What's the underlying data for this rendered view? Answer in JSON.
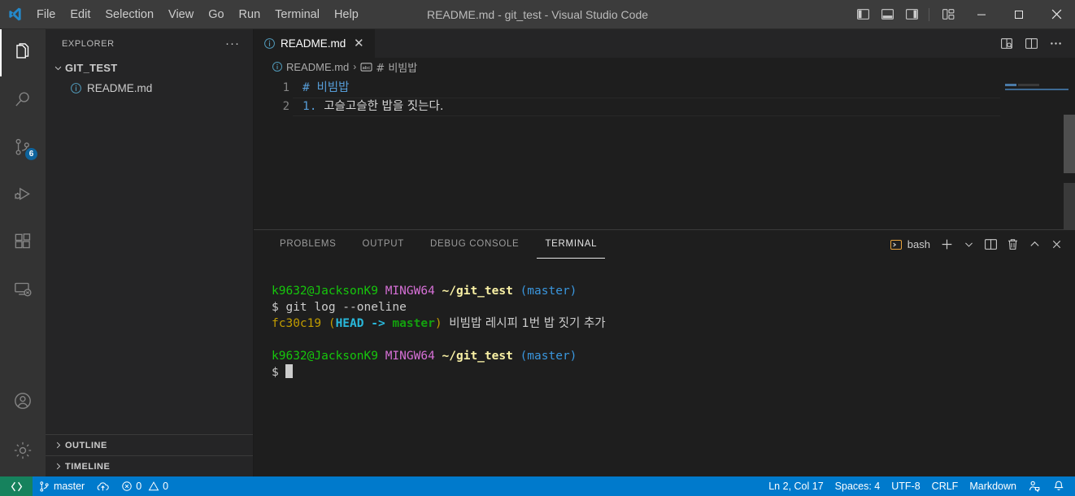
{
  "titlebar": {
    "logo_icon": "vscode-logo-icon",
    "menu": [
      {
        "label": "File"
      },
      {
        "label": "Edit"
      },
      {
        "label": "Selection"
      },
      {
        "label": "View"
      },
      {
        "label": "Go"
      },
      {
        "label": "Run"
      },
      {
        "label": "Terminal"
      },
      {
        "label": "Help"
      }
    ],
    "window_title": "README.md - git_test - Visual Studio Code",
    "layout_controls": [
      {
        "icon": "toggle-primary-sidebar-icon"
      },
      {
        "icon": "toggle-panel-icon"
      },
      {
        "icon": "toggle-secondary-sidebar-icon"
      },
      {
        "icon": "customize-layout-icon"
      }
    ],
    "window_controls": [
      {
        "icon": "minimize-icon"
      },
      {
        "icon": "maximize-icon"
      },
      {
        "icon": "close-icon"
      }
    ]
  },
  "activitybar": {
    "items": [
      {
        "name": "explorer",
        "icon": "files-icon",
        "active": true,
        "badge": null
      },
      {
        "name": "search",
        "icon": "search-icon",
        "active": false,
        "badge": null
      },
      {
        "name": "source-control",
        "icon": "source-control-icon",
        "active": false,
        "badge": "6"
      },
      {
        "name": "run-and-debug",
        "icon": "run-debug-icon",
        "active": false,
        "badge": null
      },
      {
        "name": "extensions",
        "icon": "extensions-icon",
        "active": false,
        "badge": null
      },
      {
        "name": "remote-explorer",
        "icon": "remote-explorer-icon",
        "active": false,
        "badge": null
      }
    ],
    "bottom_items": [
      {
        "name": "accounts",
        "icon": "account-icon"
      },
      {
        "name": "manage",
        "icon": "gear-icon"
      }
    ]
  },
  "sidebar": {
    "title": "EXPLORER",
    "more_actions": "···",
    "folder": {
      "label": "GIT_TEST",
      "expanded": true,
      "chevron": "chevron-down-icon"
    },
    "files": [
      {
        "label": "README.md",
        "icon": "markdown-info-icon"
      }
    ],
    "sections": [
      {
        "label": "OUTLINE",
        "chevron": "chevron-right-icon"
      },
      {
        "label": "TIMELINE",
        "chevron": "chevron-right-icon"
      }
    ]
  },
  "editor": {
    "tab": {
      "label": "README.md",
      "icon": "markdown-info-icon",
      "close": "✕"
    },
    "actions": [
      {
        "icon": "open-preview-to-side-icon"
      },
      {
        "icon": "split-editor-icon"
      },
      {
        "icon": "more-actions-icon"
      }
    ],
    "breadcrumb": {
      "file": "README.md",
      "file_icon": "markdown-info-icon",
      "separator": "›",
      "symbol_icon": "symbol-string-icon",
      "symbol": "# 비빔밥"
    },
    "lines": [
      {
        "num": "1",
        "hash": "# ",
        "text": "비빔밥",
        "kind": "heading",
        "current": false
      },
      {
        "num": "2",
        "hash": "1. ",
        "text": "고슬고슬한 밥을 짓는다.",
        "kind": "listitem",
        "current": true
      }
    ]
  },
  "panel": {
    "tabs": [
      {
        "label": "PROBLEMS",
        "active": false
      },
      {
        "label": "OUTPUT",
        "active": false
      },
      {
        "label": "DEBUG CONSOLE",
        "active": false
      },
      {
        "label": "TERMINAL",
        "active": true
      }
    ],
    "shell": {
      "label": "bash",
      "icon": "terminal-bash-icon"
    },
    "actions": [
      {
        "icon": "add-terminal-icon"
      },
      {
        "icon": "chevron-down-icon"
      },
      {
        "icon": "split-terminal-icon"
      },
      {
        "icon": "trash-icon"
      },
      {
        "icon": "maximize-panel-icon"
      },
      {
        "icon": "close-panel-icon"
      }
    ],
    "terminal": {
      "prompt_user": "k9632@JacksonK9",
      "prompt_shell": "MINGW64",
      "prompt_path": "~/git_test",
      "prompt_branch": "(master)",
      "dollar": "$ ",
      "command": "git log --oneline",
      "log_hash": "fc30c19",
      "log_paren_open": " (",
      "log_head": "HEAD -> ",
      "log_branch": "master",
      "log_paren_close": ") ",
      "log_message": "비빔밥 레시피 1번 밥 짓기 추가"
    }
  },
  "statusbar": {
    "remote_icon": "remote-window-icon",
    "branch_icon": "source-control-icon",
    "branch": "master",
    "sync_icon": "cloud-upload-icon",
    "errors_icon": "error-icon",
    "errors": "0",
    "warnings_icon": "warning-icon",
    "warnings": "0",
    "cursor_position": "Ln 2, Col 17",
    "indentation": "Spaces: 4",
    "encoding": "UTF-8",
    "eol": "CRLF",
    "language": "Markdown",
    "feedback_icon": "feedback-person-icon",
    "bell_icon": "bell-icon"
  },
  "colors": {
    "accent": "#007acc",
    "remote_green": "#16825d",
    "badge_blue": "#0e639c",
    "editor_bg": "#1e1e1e",
    "sidebar_bg": "#252526",
    "activitybar_bg": "#333333",
    "titlebar_bg": "#3c3c3c"
  }
}
